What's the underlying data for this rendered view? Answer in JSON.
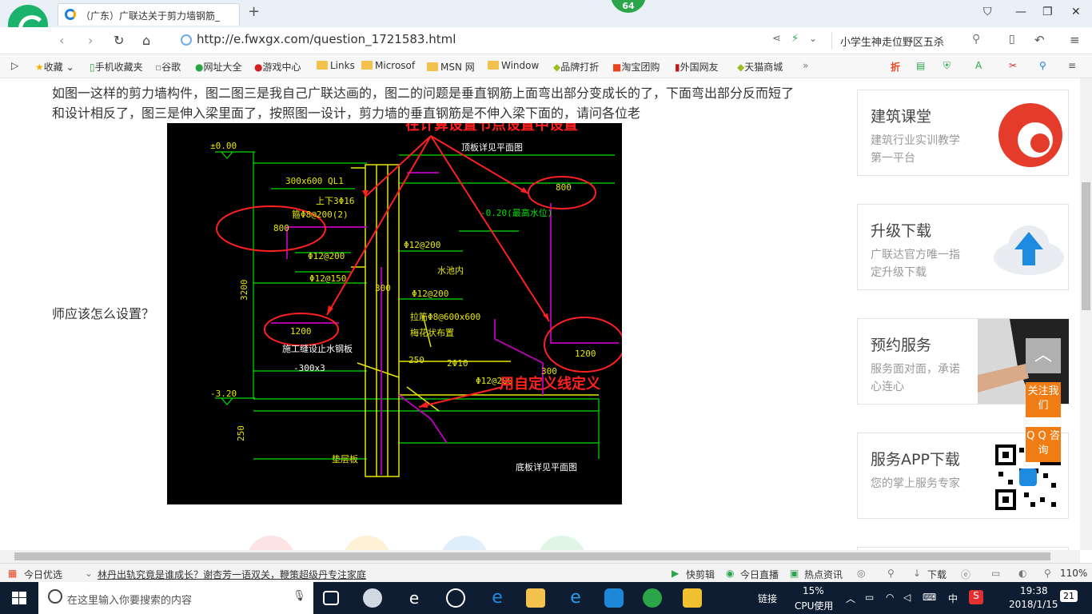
{
  "browser": {
    "tab_title": "（广东）广联达关于剪力墙钢筋_",
    "tab_close": "×",
    "new_tab": "+",
    "badge": "64",
    "url": "http://e.fwxgx.com/question_1721583.html",
    "search_text": "小学生神走位野区五杀"
  },
  "favorites": [
    {
      "label": "收藏"
    },
    {
      "label": "手机收藏夹"
    },
    {
      "label": "谷歌"
    },
    {
      "label": "网址大全"
    },
    {
      "label": "游戏中心"
    },
    {
      "label": "Links"
    },
    {
      "label": "Microsof"
    },
    {
      "label": "MSN 网"
    },
    {
      "label": "Window"
    },
    {
      "label": "品牌打折"
    },
    {
      "label": "淘宝团购"
    },
    {
      "label": "外国网友"
    },
    {
      "label": "天猫商城"
    }
  ],
  "question": {
    "body": "如图一这样的剪力墙构件，图二图三是我自己广联达画的，图二的问题是垂直钢筋上面弯出部分变成长的了，下面弯出部分反而短了和设计相反了，图三是伸入梁里面了，按照图一设计，剪力墙的垂直钢筋是不伸入梁下面的，请问各位老",
    "tail": "师应该怎么设置？"
  },
  "drawing": {
    "note_top": "在计算设置节点设置中设置",
    "note_bottom": "用自定义线定义",
    "elev_top": "±0.00",
    "elev_bottom": "-3.20",
    "beam": "300x600   QL1",
    "rebar_top": "上下3Φ16",
    "stirrup": "箍Φ8@200(2)",
    "dim_800_left": "800",
    "dim_800_right": "800",
    "dim_1200_left": "1200",
    "dim_1200_right": "1200",
    "phi12_200_a": "Φ12@200",
    "phi12_200_b": "Φ12@200",
    "phi12_150": "Φ12@150",
    "phi12_200_c": "Φ12@200",
    "phi12_200_d": "Φ12@200",
    "dim_300": "300",
    "dim_3200": "3200",
    "water": "水池内",
    "elev_water": "-0.20(最高水位)",
    "top_plan": "顶板详见平面图",
    "tie": "拉筋Φ8@600x600",
    "tie2": "梅花状布置",
    "waterstop": "施工缝设止水钢板",
    "size_300x3": "-300x3",
    "dim_250": "250",
    "bars_2phi10": "2Φ10",
    "dim_300b": "300",
    "dim_250b": "250",
    "bottom_plan": "底板详见平面图",
    "cushion": "垫层板"
  },
  "sidebar": [
    {
      "title": "建筑课堂",
      "desc": "建筑行业实训教学第一平台"
    },
    {
      "title": "升级下载",
      "desc": "广联达官方唯一指定升级下载"
    },
    {
      "title": "预约服务",
      "desc": "服务面对面，承诺心连心"
    },
    {
      "title": "服务APP下载",
      "desc": "您的掌上服务专家"
    }
  ],
  "float_buttons": {
    "follow": "关注我们",
    "qq": "Q Q 咨询"
  },
  "statusbar": {
    "today": "今日优选",
    "news": "林丹出轨究竟是谁成长？谢杏芳一语双关，鞭策超级丹专注家庭",
    "quick_cut": "快剪辑",
    "live": "今日直播",
    "hot": "热点资讯",
    "download": "下载",
    "zoom": "110%"
  },
  "taskbar": {
    "search_placeholder": "在这里输入你要搜索的内容",
    "link": "链接",
    "cpu_pct": "15%",
    "cpu_label": "CPU使用",
    "ime": "中",
    "time": "19:38",
    "date": "2018/1/15",
    "notif": "21"
  },
  "colors": {
    "cad_yellow": "#e6e600",
    "cad_green": "#00e000",
    "cad_magenta": "#c000c0",
    "annot_red": "#ff2020",
    "accent_orange": "#f07c13"
  }
}
